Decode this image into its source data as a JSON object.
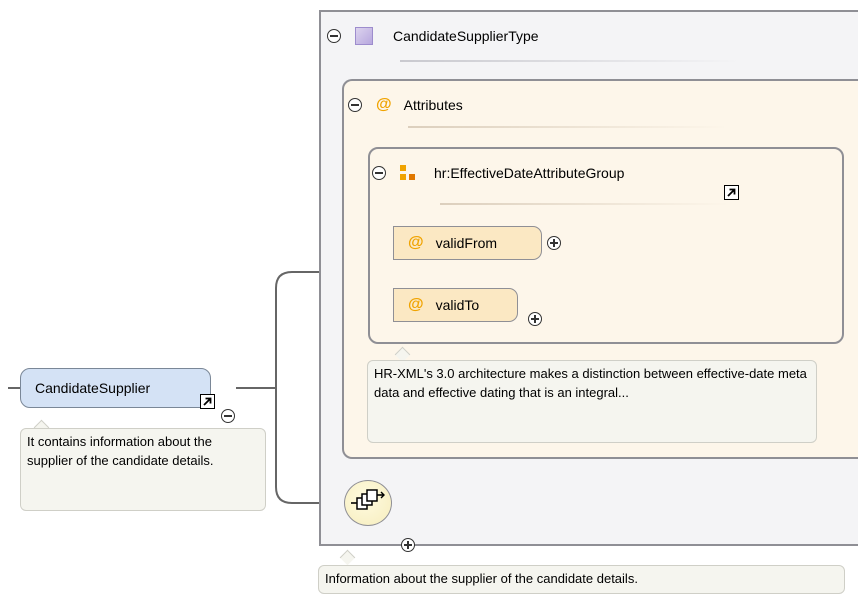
{
  "type_box": {
    "name": "CandidateSupplierType",
    "icon": "complex-type-icon"
  },
  "attributes_box": {
    "label": "Attributes",
    "icon": "attribute-icon"
  },
  "attribute_group": {
    "name": "hr:EffectiveDateAttributeGroup",
    "icon": "attribute-group-icon",
    "attributes": [
      {
        "name": "validFrom",
        "icon": "attribute-icon"
      },
      {
        "name": "validTo",
        "icon": "attribute-icon"
      }
    ],
    "annotation": "HR-XML's 3.0 architecture makes a distinction between effective-date meta data and effective dating that is an integral..."
  },
  "root_element": {
    "name": "CandidateSupplier",
    "annotation": "It contains information about the supplier of the candidate details."
  },
  "sequence": {
    "icon": "sequence-compositor-icon"
  },
  "type_annotation": "Information about the supplier of the candidate details.",
  "colors": {
    "element_fill": "#d4e2f5",
    "attribute_fill": "#fbe8c3",
    "attributes_panel": "#fdf6ea",
    "type_panel": "#f4f4f6",
    "accent_orange": "#f0a300",
    "complex_type_purple": "#b7a7de",
    "border": "#8f8f95"
  }
}
